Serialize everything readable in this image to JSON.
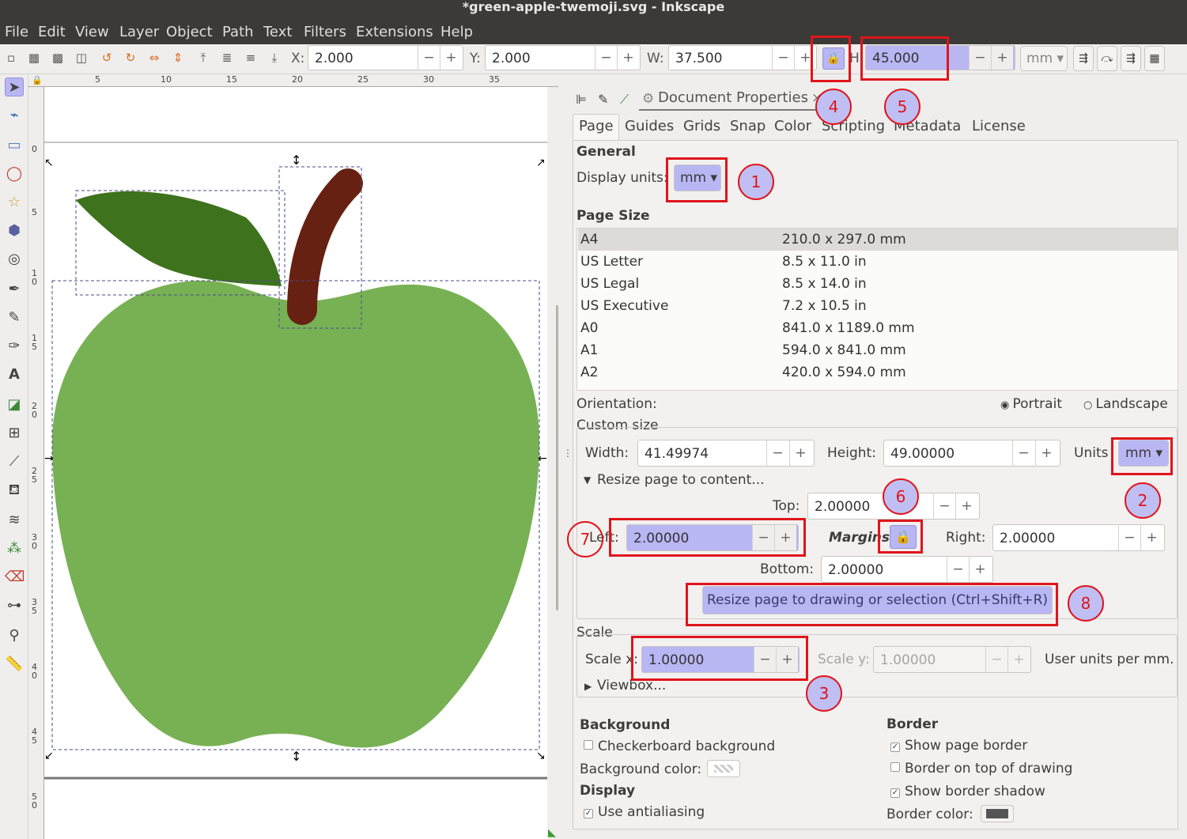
{
  "window": {
    "title": "*green-apple-twemoji.svg - Inkscape"
  },
  "menu": [
    "File",
    "Edit",
    "View",
    "Layer",
    "Object",
    "Path",
    "Text",
    "Filters",
    "Extensions",
    "Help"
  ],
  "toolbar": {
    "x_label": "X:",
    "x_value": "2.000",
    "y_label": "Y:",
    "y_value": "2.000",
    "w_label": "W:",
    "w_value": "37.500",
    "h_label": "H:",
    "h_value": "45.000",
    "units": "mm",
    "minus": "−",
    "plus": "+"
  },
  "ruler": {
    "top": [
      "5",
      "10",
      "15",
      "20",
      "25",
      "30",
      "35"
    ],
    "left": [
      "0",
      "5",
      "1\n0",
      "1\n5",
      "2\n0",
      "2\n5",
      "3\n0",
      "3\n5",
      "4\n0",
      "4\n5",
      "5\n0"
    ]
  },
  "panel": {
    "dialog_title": "Document Properties",
    "close": "×",
    "tabs": [
      "Page",
      "Guides",
      "Grids",
      "Snap",
      "Color",
      "Scripting",
      "Metadata",
      "License"
    ],
    "general": "General",
    "display_units_label": "Display units:",
    "display_units": "mm",
    "page_size": "Page Size",
    "sizes": [
      {
        "name": "A4",
        "dims": "210.0 x 297.0 mm"
      },
      {
        "name": "US Letter",
        "dims": "8.5 x 11.0 in"
      },
      {
        "name": "US Legal",
        "dims": "8.5 x 14.0 in"
      },
      {
        "name": "US Executive",
        "dims": "7.2 x 10.5 in"
      },
      {
        "name": "A0",
        "dims": "841.0 x 1189.0 mm"
      },
      {
        "name": "A1",
        "dims": "594.0 x 841.0 mm"
      },
      {
        "name": "A2",
        "dims": "420.0 x 594.0 mm"
      }
    ],
    "orientation_label": "Orientation:",
    "portrait": "Portrait",
    "landscape": "Landscape",
    "custom_size": "Custom size",
    "width_label": "Width:",
    "width_value": "41.49974",
    "height_label": "Height:",
    "height_value": "49.00000",
    "units_label": "Units",
    "units_value": "mm",
    "resize_expander": "Resize page to content...",
    "top_label": "Top:",
    "top_value": "2.00000",
    "left_label": "Left:",
    "left_value": "2.00000",
    "margins_label": "Margins",
    "right_label": "Right:",
    "right_value": "2.00000",
    "bottom_label": "Bottom:",
    "bottom_value": "2.00000",
    "resize_button": "Resize page to drawing or selection (Ctrl+Shift+R)",
    "scale": "Scale",
    "scale_x_label": "Scale x:",
    "scale_x_value": "1.00000",
    "scale_y_label": "Scale y:",
    "scale_y_value": "1.00000",
    "user_units": "User units per mm.",
    "viewbox": "Viewbox...",
    "background": "Background",
    "checkerboard": "Checkerboard background",
    "bg_color_label": "Background color:",
    "display": "Display",
    "antialias": "Use antialiasing",
    "border": "Border",
    "show_border": "Show page border",
    "border_on_top": "Border on top of drawing",
    "border_shadow": "Show border shadow",
    "border_color_label": "Border color:"
  },
  "markers": [
    "1",
    "2",
    "3",
    "4",
    "5",
    "6",
    "7",
    "8"
  ],
  "colors": {
    "apple": "#78b154",
    "leaf": "#3e721d",
    "stem": "#662113",
    "highlight": "#b8b6f3",
    "annotation": "#e0141c"
  }
}
